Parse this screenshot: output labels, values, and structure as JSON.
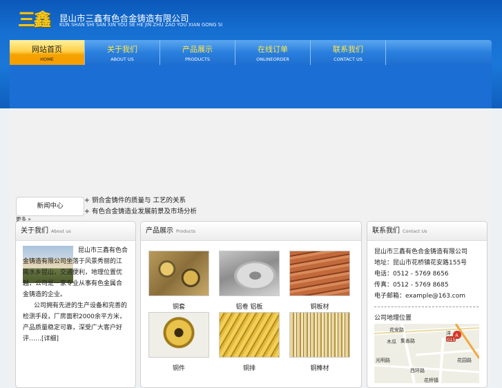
{
  "header": {
    "logo_text": "三鑫",
    "company_cn": "昆山市三鑫有色合金铸造有限公司",
    "company_en": "KUN SHAN SHI SAN XIN YOU SE HE JIN ZHU ZAO YOU XIAN GONG SI"
  },
  "nav": [
    {
      "cn": "网站首页",
      "en": "HOME"
    },
    {
      "cn": "关于我们",
      "en": "ABOUT US"
    },
    {
      "cn": "产品展示",
      "en": "PRODUCTS"
    },
    {
      "cn": "在线订单",
      "en": "ONLINEORDER"
    },
    {
      "cn": "联系我们",
      "en": "CONTACT US"
    }
  ],
  "news": {
    "box_label": "新闻中心",
    "items": [
      "+ 铜合金铸件的质量与 工艺的关系",
      "+ 有色合金铸造业发展前景及市场分析"
    ],
    "more": "更多 »"
  },
  "about": {
    "title": "关于我们",
    "subtitle": "About us",
    "text1": "昆山市三鑫有色合金铸造有限公司坐落于风景秀丽的江南水乡昆山，交通便利，地理位置优越，公司是一家专业从事有色金属合金铸造的企业。",
    "text2": "公司拥有先进的生产设备和完善的检测手段，厂房面积2000余平方米，产品质量稳定可靠，深受广大客户好评……",
    "more": "[详细]"
  },
  "products": {
    "title": "产品展示",
    "subtitle": "Products",
    "items": [
      {
        "name": "铜套"
      },
      {
        "name": "铝卷 铝板"
      },
      {
        "name": "铜板材"
      },
      {
        "name": "铜件"
      },
      {
        "name": "铜排"
      },
      {
        "name": "铜棒材"
      }
    ]
  },
  "contact": {
    "title": "联系我们",
    "subtitle": "Contact Us",
    "lines": [
      "昆山市三鑫有色合金铸造有限公司",
      "地址：昆山市花桥镇花安路155号",
      "电话：0512 - 5769 8656",
      "传真：0512 - 5769 8685",
      "电子邮箱：example@163.com"
    ],
    "map_title": "公司地理位置",
    "map_labels": [
      "花安路",
      "木瓜",
      "集善路",
      "光明路",
      "花园路",
      "西环路",
      "花桥镇",
      "洋",
      "G15"
    ]
  }
}
